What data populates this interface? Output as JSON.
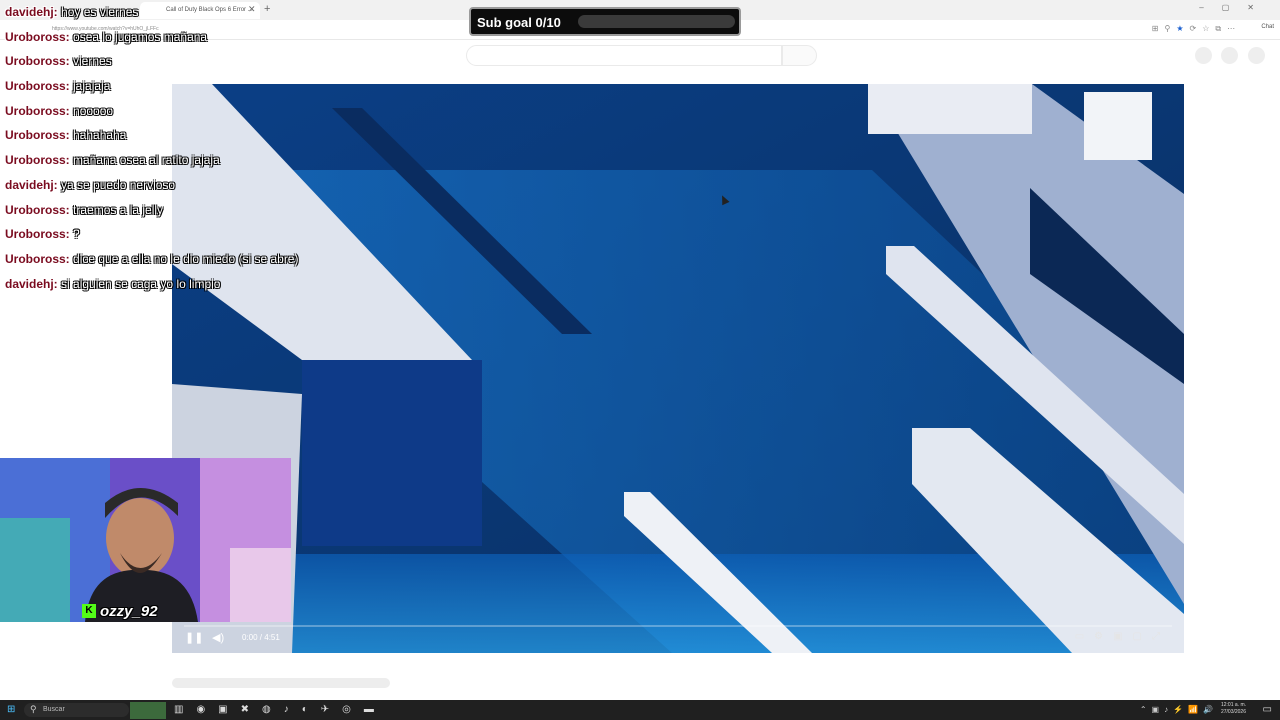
{
  "browser": {
    "tab_title": "Call of Duty Black Ops 6 Error ...",
    "url": "https://www.youtube.com/watch?v=hUhO_jLFFc",
    "chat_button": "Chat"
  },
  "subgoal": {
    "label": "Sub goal 0/10",
    "progress": 0
  },
  "chat": [
    {
      "user": "davidehj:",
      "msg": "hoy es viernes"
    },
    {
      "user": "Uroboross:",
      "msg": "osea lo jugamos mañana"
    },
    {
      "user": "Uroboross:",
      "msg": "viernes"
    },
    {
      "user": "Uroboross:",
      "msg": "jajajaja"
    },
    {
      "user": "Uroboross:",
      "msg": "nooooo"
    },
    {
      "user": "Uroboross:",
      "msg": "hahahaha"
    },
    {
      "user": "Uroboross:",
      "msg": "mañana osea al ratito jajaja"
    },
    {
      "user": "davidehj:",
      "msg": "ya se puedo nervioso"
    },
    {
      "user": "Uroboross:",
      "msg": "traemos a la jelly"
    },
    {
      "user": "Uroboross:",
      "msg": "?"
    },
    {
      "user": "Uroboross:",
      "msg": "dice que a ella no le dio miedo (si se abre)"
    },
    {
      "user": "davidehj:",
      "msg": "si alguien se caga yo lo limpio"
    }
  ],
  "player": {
    "time": "0:00 / 4:51",
    "progress": 0
  },
  "webcam": {
    "name": "ozzy_92",
    "badge": "K"
  },
  "taskbar": {
    "search_label": "Buscar",
    "clock_time": "12:01 a. m.",
    "clock_date": "27/03/2026"
  },
  "colors": {
    "chat_username": "#7a0b1f",
    "player_blue": "#0a3b78",
    "kick_green": "#53fc18"
  }
}
